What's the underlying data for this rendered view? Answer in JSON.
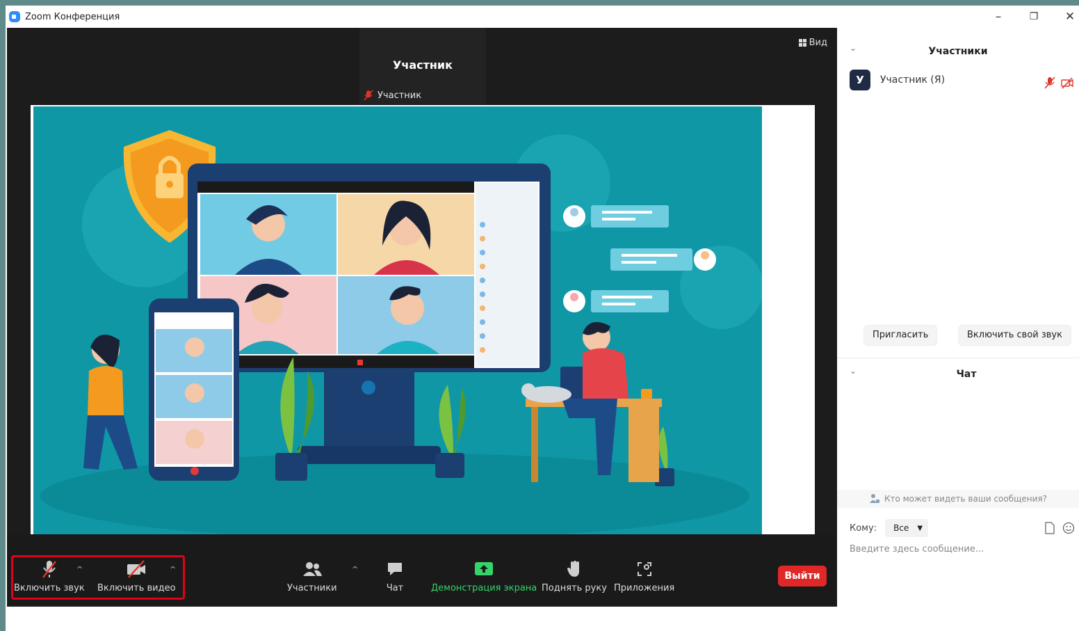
{
  "window": {
    "title": "Zoom Конференция",
    "controls": {
      "minimize": "–",
      "restore": "❐",
      "close": "✕"
    }
  },
  "stage": {
    "active_speaker_name": "Участник",
    "active_speaker_label": "Участник",
    "view_label": "Вид"
  },
  "toolbar": {
    "mute_label": "Включить звук",
    "video_label": "Включить видео",
    "participants_label": "Участники",
    "chat_label": "Чат",
    "share_label": "Демонстрация экрана",
    "raise_hand_label": "Поднять руку",
    "apps_label": "Приложения",
    "leave_label": "Выйти",
    "caret": "^",
    "colors": {
      "share_green": "#35d46a",
      "leave_red": "#e02828",
      "highlight": "#e0001b"
    }
  },
  "participants_panel": {
    "title": "Участники",
    "items": [
      {
        "initial": "У",
        "name": "Участник (Я)"
      }
    ],
    "invite_label": "Пригласить",
    "unmute_self_label": "Включить свой звук"
  },
  "chat_panel": {
    "title": "Чат",
    "who_can_see": "Кто может видеть ваши сообщения?",
    "to_label": "Кому:",
    "to_value": "Все",
    "input_placeholder": "Введите здесь сообщение..."
  },
  "icons": {
    "mic": "mic-muted-icon",
    "video": "video-off-icon",
    "participants": "participants-icon",
    "chat": "chat-icon",
    "share": "share-screen-icon",
    "hand": "raise-hand-icon",
    "apps": "apps-icon"
  }
}
